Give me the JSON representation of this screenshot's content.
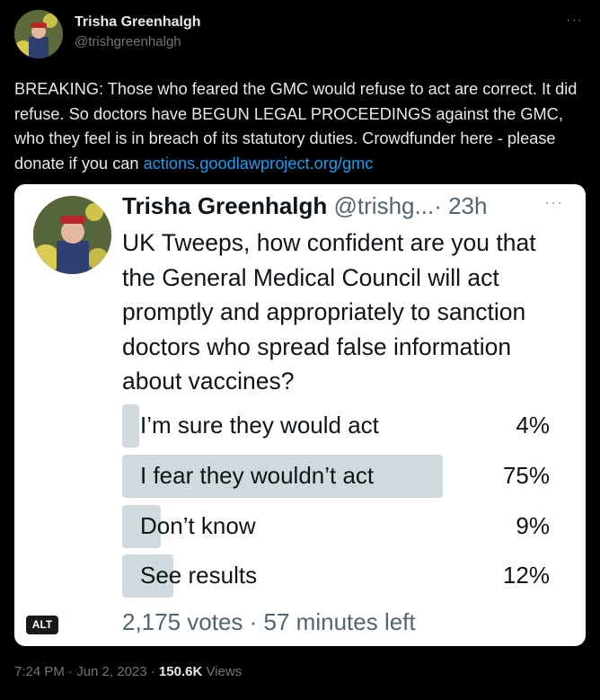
{
  "author": {
    "name": "Trisha Greenhalgh",
    "handle": "@trishgreenhalgh",
    "more": "···"
  },
  "tweet": {
    "text": "BREAKING: Those who feared the GMC would refuse to act are correct. It did refuse. So doctors have BEGUN LEGAL PROCEEDINGS against the GMC, who they feel is in breach of its statutory duties. Crowdfunder here - please donate if you can ",
    "link": "actions.goodlawproject.org/gmc"
  },
  "quoted": {
    "name": "Trisha Greenhalgh",
    "handle": "@trishg...",
    "time": "· 23h",
    "more": "···",
    "text": "UK Tweeps, how confident are you that the General Medical Council will act promptly and appropriately to sanction doctors who spread false information about vaccines?",
    "poll": {
      "options": [
        {
          "label": "I’m sure they would act",
          "pct": "4%",
          "value": 4
        },
        {
          "label": "I fear they wouldn’t act",
          "pct": "75%",
          "value": 75
        },
        {
          "label": "Don’t know",
          "pct": "9%",
          "value": 9
        },
        {
          "label": "See results",
          "pct": "12%",
          "value": 12
        }
      ],
      "footer": "2,175 votes · 57 minutes left"
    },
    "alt_badge": "ALT"
  },
  "meta": {
    "time_date": "7:24 PM · Jun 2, 2023 · ",
    "views_count": "150.6K",
    "views_label": " Views"
  },
  "colors": {
    "background": "#000000",
    "link": "#1d9bf0",
    "poll_bar": "#cfd9de",
    "muted": "#71767b"
  }
}
